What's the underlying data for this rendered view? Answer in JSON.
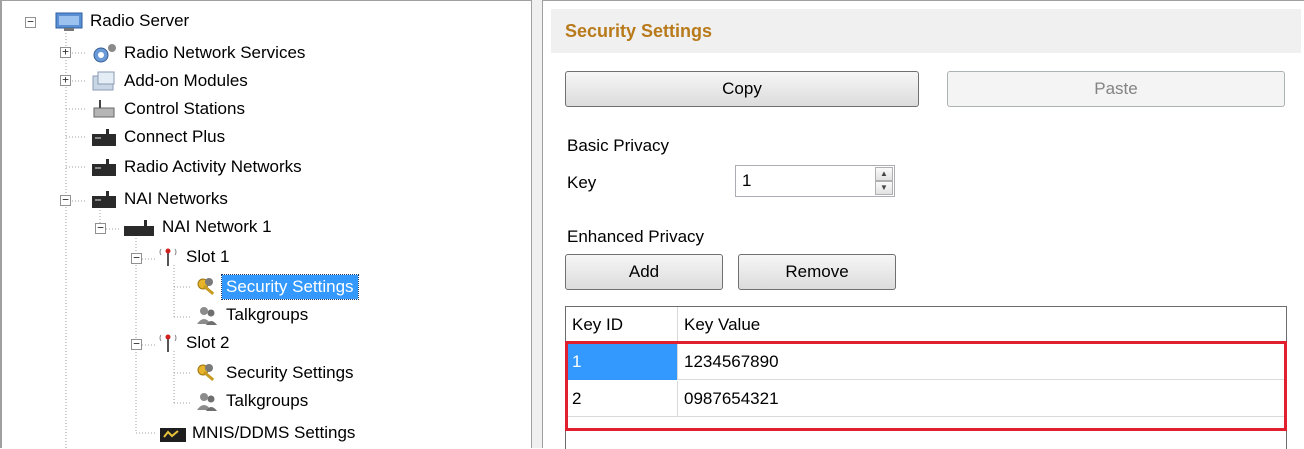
{
  "tree": {
    "items": [
      {
        "label": "Radio Server",
        "icon": "server-icon",
        "expander": "minus",
        "selected": false
      },
      {
        "label": "Radio Network Services",
        "icon": "network-services-icon",
        "expander": "plus",
        "selected": false
      },
      {
        "label": "Add-on Modules",
        "icon": "modules-icon",
        "expander": "plus",
        "selected": false
      },
      {
        "label": "Control Stations",
        "icon": "control-station-icon",
        "expander": "",
        "selected": false
      },
      {
        "label": "Connect Plus",
        "icon": "repeater-icon",
        "expander": "",
        "selected": false
      },
      {
        "label": "Radio Activity Networks",
        "icon": "repeater-icon",
        "expander": "",
        "selected": false
      },
      {
        "label": "NAI Networks",
        "icon": "repeater-icon",
        "expander": "minus",
        "selected": false
      },
      {
        "label": "NAI Network 1",
        "icon": "repeater-icon",
        "expander": "minus",
        "selected": false
      },
      {
        "label": "Slot 1",
        "icon": "antenna-icon",
        "expander": "minus",
        "selected": false
      },
      {
        "label": "Security Settings",
        "icon": "keys-icon",
        "expander": "",
        "selected": true
      },
      {
        "label": "Talkgroups",
        "icon": "users-icon",
        "expander": "",
        "selected": false
      },
      {
        "label": "Slot 2",
        "icon": "antenna-icon",
        "expander": "minus",
        "selected": false
      },
      {
        "label": "Security Settings",
        "icon": "keys-icon",
        "expander": "",
        "selected": false
      },
      {
        "label": "Talkgroups",
        "icon": "users-icon",
        "expander": "",
        "selected": false
      },
      {
        "label": "MNIS/DDMS Settings",
        "icon": "monitor-icon",
        "expander": "",
        "selected": false
      }
    ]
  },
  "panel": {
    "title": "Security Settings",
    "copy_label": "Copy",
    "paste_label": "Paste",
    "basic_privacy_label": "Basic Privacy",
    "key_label": "Key",
    "key_value": "1",
    "enhanced_privacy_label": "Enhanced Privacy",
    "add_label": "Add",
    "remove_label": "Remove"
  },
  "grid": {
    "columns": [
      "Key ID",
      "Key Value"
    ],
    "rows": [
      {
        "id": "1",
        "value": "1234567890"
      },
      {
        "id": "2",
        "value": "0987654321"
      }
    ]
  },
  "colors": {
    "title": "#b87a1a",
    "selection": "#3399ff",
    "highlight_border": "#e0202e"
  }
}
